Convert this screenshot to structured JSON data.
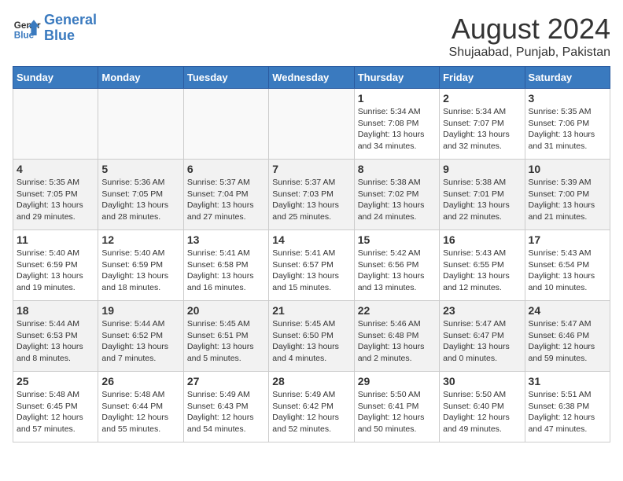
{
  "logo": {
    "line1": "General",
    "line2": "Blue"
  },
  "title": "August 2024",
  "subtitle": "Shujaabad, Punjab, Pakistan",
  "weekdays": [
    "Sunday",
    "Monday",
    "Tuesday",
    "Wednesday",
    "Thursday",
    "Friday",
    "Saturday"
  ],
  "weeks": [
    [
      {
        "day": "",
        "info": ""
      },
      {
        "day": "",
        "info": ""
      },
      {
        "day": "",
        "info": ""
      },
      {
        "day": "",
        "info": ""
      },
      {
        "day": "1",
        "info": "Sunrise: 5:34 AM\nSunset: 7:08 PM\nDaylight: 13 hours\nand 34 minutes."
      },
      {
        "day": "2",
        "info": "Sunrise: 5:34 AM\nSunset: 7:07 PM\nDaylight: 13 hours\nand 32 minutes."
      },
      {
        "day": "3",
        "info": "Sunrise: 5:35 AM\nSunset: 7:06 PM\nDaylight: 13 hours\nand 31 minutes."
      }
    ],
    [
      {
        "day": "4",
        "info": "Sunrise: 5:35 AM\nSunset: 7:05 PM\nDaylight: 13 hours\nand 29 minutes."
      },
      {
        "day": "5",
        "info": "Sunrise: 5:36 AM\nSunset: 7:05 PM\nDaylight: 13 hours\nand 28 minutes."
      },
      {
        "day": "6",
        "info": "Sunrise: 5:37 AM\nSunset: 7:04 PM\nDaylight: 13 hours\nand 27 minutes."
      },
      {
        "day": "7",
        "info": "Sunrise: 5:37 AM\nSunset: 7:03 PM\nDaylight: 13 hours\nand 25 minutes."
      },
      {
        "day": "8",
        "info": "Sunrise: 5:38 AM\nSunset: 7:02 PM\nDaylight: 13 hours\nand 24 minutes."
      },
      {
        "day": "9",
        "info": "Sunrise: 5:38 AM\nSunset: 7:01 PM\nDaylight: 13 hours\nand 22 minutes."
      },
      {
        "day": "10",
        "info": "Sunrise: 5:39 AM\nSunset: 7:00 PM\nDaylight: 13 hours\nand 21 minutes."
      }
    ],
    [
      {
        "day": "11",
        "info": "Sunrise: 5:40 AM\nSunset: 6:59 PM\nDaylight: 13 hours\nand 19 minutes."
      },
      {
        "day": "12",
        "info": "Sunrise: 5:40 AM\nSunset: 6:59 PM\nDaylight: 13 hours\nand 18 minutes."
      },
      {
        "day": "13",
        "info": "Sunrise: 5:41 AM\nSunset: 6:58 PM\nDaylight: 13 hours\nand 16 minutes."
      },
      {
        "day": "14",
        "info": "Sunrise: 5:41 AM\nSunset: 6:57 PM\nDaylight: 13 hours\nand 15 minutes."
      },
      {
        "day": "15",
        "info": "Sunrise: 5:42 AM\nSunset: 6:56 PM\nDaylight: 13 hours\nand 13 minutes."
      },
      {
        "day": "16",
        "info": "Sunrise: 5:43 AM\nSunset: 6:55 PM\nDaylight: 13 hours\nand 12 minutes."
      },
      {
        "day": "17",
        "info": "Sunrise: 5:43 AM\nSunset: 6:54 PM\nDaylight: 13 hours\nand 10 minutes."
      }
    ],
    [
      {
        "day": "18",
        "info": "Sunrise: 5:44 AM\nSunset: 6:53 PM\nDaylight: 13 hours\nand 8 minutes."
      },
      {
        "day": "19",
        "info": "Sunrise: 5:44 AM\nSunset: 6:52 PM\nDaylight: 13 hours\nand 7 minutes."
      },
      {
        "day": "20",
        "info": "Sunrise: 5:45 AM\nSunset: 6:51 PM\nDaylight: 13 hours\nand 5 minutes."
      },
      {
        "day": "21",
        "info": "Sunrise: 5:45 AM\nSunset: 6:50 PM\nDaylight: 13 hours\nand 4 minutes."
      },
      {
        "day": "22",
        "info": "Sunrise: 5:46 AM\nSunset: 6:48 PM\nDaylight: 13 hours\nand 2 minutes."
      },
      {
        "day": "23",
        "info": "Sunrise: 5:47 AM\nSunset: 6:47 PM\nDaylight: 13 hours\nand 0 minutes."
      },
      {
        "day": "24",
        "info": "Sunrise: 5:47 AM\nSunset: 6:46 PM\nDaylight: 12 hours\nand 59 minutes."
      }
    ],
    [
      {
        "day": "25",
        "info": "Sunrise: 5:48 AM\nSunset: 6:45 PM\nDaylight: 12 hours\nand 57 minutes."
      },
      {
        "day": "26",
        "info": "Sunrise: 5:48 AM\nSunset: 6:44 PM\nDaylight: 12 hours\nand 55 minutes."
      },
      {
        "day": "27",
        "info": "Sunrise: 5:49 AM\nSunset: 6:43 PM\nDaylight: 12 hours\nand 54 minutes."
      },
      {
        "day": "28",
        "info": "Sunrise: 5:49 AM\nSunset: 6:42 PM\nDaylight: 12 hours\nand 52 minutes."
      },
      {
        "day": "29",
        "info": "Sunrise: 5:50 AM\nSunset: 6:41 PM\nDaylight: 12 hours\nand 50 minutes."
      },
      {
        "day": "30",
        "info": "Sunrise: 5:50 AM\nSunset: 6:40 PM\nDaylight: 12 hours\nand 49 minutes."
      },
      {
        "day": "31",
        "info": "Sunrise: 5:51 AM\nSunset: 6:38 PM\nDaylight: 12 hours\nand 47 minutes."
      }
    ]
  ]
}
